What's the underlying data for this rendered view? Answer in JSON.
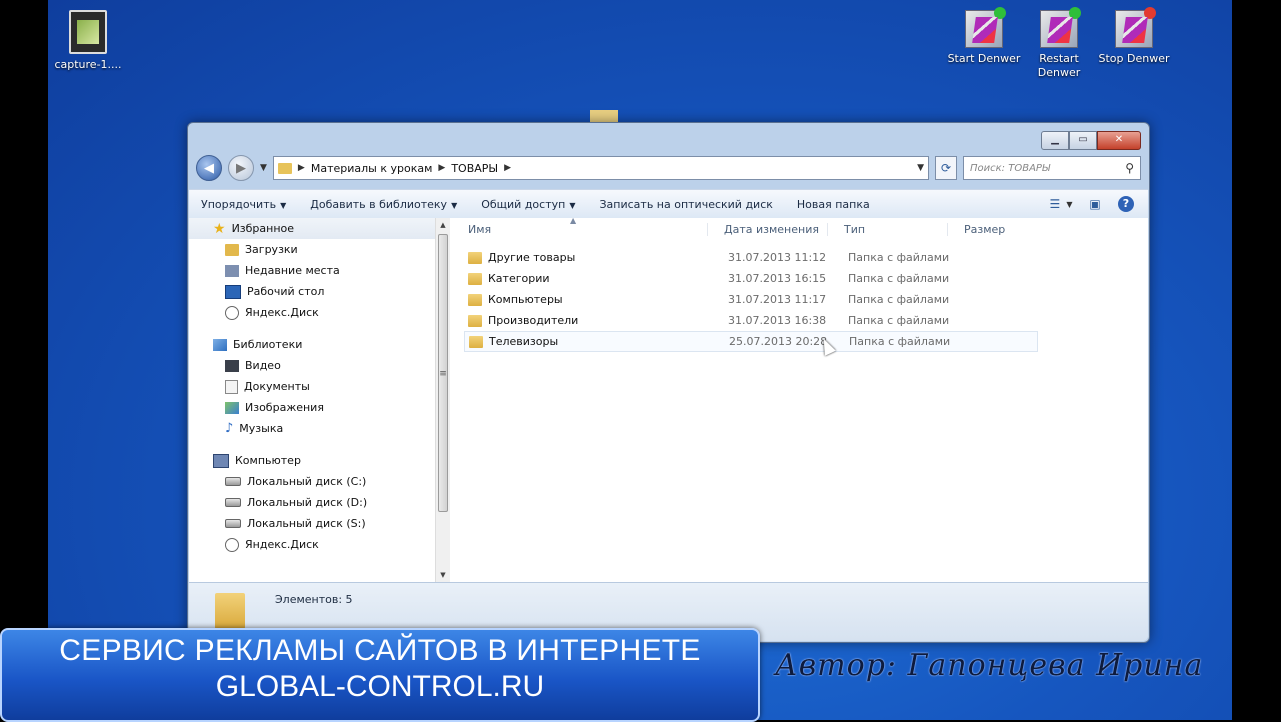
{
  "desktop": {
    "icons": [
      {
        "label": "capture-1...."
      },
      {
        "label": "Start Denwer"
      },
      {
        "label": "Restart Denwer"
      },
      {
        "label": "Stop Denwer"
      }
    ]
  },
  "window": {
    "address": {
      "segments": [
        "Материалы к урокам",
        "ТОВАРЫ"
      ]
    },
    "search": {
      "placeholder": "Поиск: ТОВАРЫ"
    },
    "toolbar": {
      "organize": "Упорядочить",
      "add_library": "Добавить в библиотеку",
      "share": "Общий доступ",
      "burn": "Записать на оптический диск",
      "new_folder": "Новая папка"
    },
    "nav": {
      "favorites": "Избранное",
      "fav_items": [
        "Загрузки",
        "Недавние места",
        "Рабочий стол",
        "Яндекс.Диск"
      ],
      "libraries": "Библиотеки",
      "lib_items": [
        "Видео",
        "Документы",
        "Изображения",
        "Музыка"
      ],
      "computer": "Компьютер",
      "comp_items": [
        "Локальный диск (C:)",
        "Локальный диск (D:)",
        "Локальный диск (S:)",
        "Яндекс.Диск"
      ]
    },
    "columns": {
      "name": "Имя",
      "date": "Дата изменения",
      "type": "Тип",
      "size": "Размер"
    },
    "files": [
      {
        "name": "Другие товары",
        "date": "31.07.2013 11:12",
        "type": "Папка с файлами"
      },
      {
        "name": "Категории",
        "date": "31.07.2013 16:15",
        "type": "Папка с файлами"
      },
      {
        "name": "Компьютеры",
        "date": "31.07.2013 11:17",
        "type": "Папка с файлами"
      },
      {
        "name": "Производители",
        "date": "31.07.2013 16:38",
        "type": "Папка с файлами"
      },
      {
        "name": "Телевизоры",
        "date": "25.07.2013 20:28",
        "type": "Папка с файлами"
      }
    ],
    "status": "Элементов: 5"
  },
  "banner": {
    "line1": "СЕРВИС РЕКЛАМЫ САЙТОВ В ИНТЕРНЕТЕ",
    "line2": "GLOBAL-CONTROL.RU"
  },
  "author": "Автор: Гапонцева Ирина"
}
